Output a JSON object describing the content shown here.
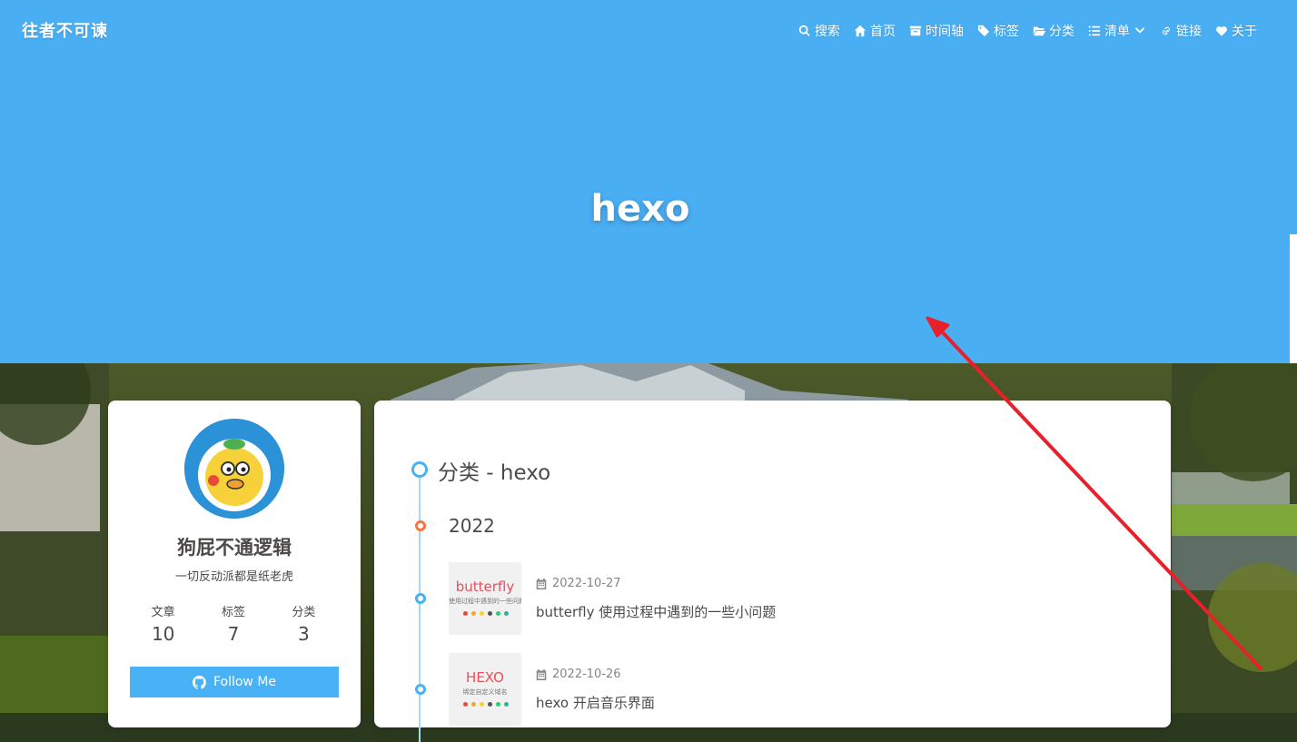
{
  "header": {
    "site_name": "往者不可谏",
    "nav": [
      {
        "label": "搜索",
        "icon": "search-icon"
      },
      {
        "label": "首页",
        "icon": "home-icon"
      },
      {
        "label": "时间轴",
        "icon": "archive-icon"
      },
      {
        "label": "标签",
        "icon": "tags-icon"
      },
      {
        "label": "分类",
        "icon": "folder-open-icon"
      },
      {
        "label": "清单",
        "icon": "list-icon"
      },
      {
        "label": "链接",
        "icon": "link-icon"
      },
      {
        "label": "关于",
        "icon": "heart-icon"
      }
    ]
  },
  "page_title": "hexo",
  "author": {
    "name": "狗屁不通逻辑",
    "description": "一切反动派都是纸老虎",
    "stats": [
      {
        "label": "文章",
        "value": "10"
      },
      {
        "label": "标签",
        "value": "7"
      },
      {
        "label": "分类",
        "value": "3"
      }
    ],
    "follow_label": "Follow Me"
  },
  "category": {
    "title": "分类 - hexo",
    "year": "2022",
    "posts": [
      {
        "date": "2022-10-27",
        "title": "butterfly 使用过程中遇到的一些小问题",
        "thumb_word": "butterfly",
        "thumb_sub": "使用过程中遇到的一些问题"
      },
      {
        "date": "2022-10-26",
        "title": "hexo 开启音乐界面",
        "thumb_word": "HEXO",
        "thumb_sub": "绑定自定义域名"
      }
    ]
  },
  "colors": {
    "banner": "#4aaef3",
    "accent": "#49b1f5",
    "year_dot": "#ff7242",
    "annotation_arrow": "#e8202a"
  }
}
